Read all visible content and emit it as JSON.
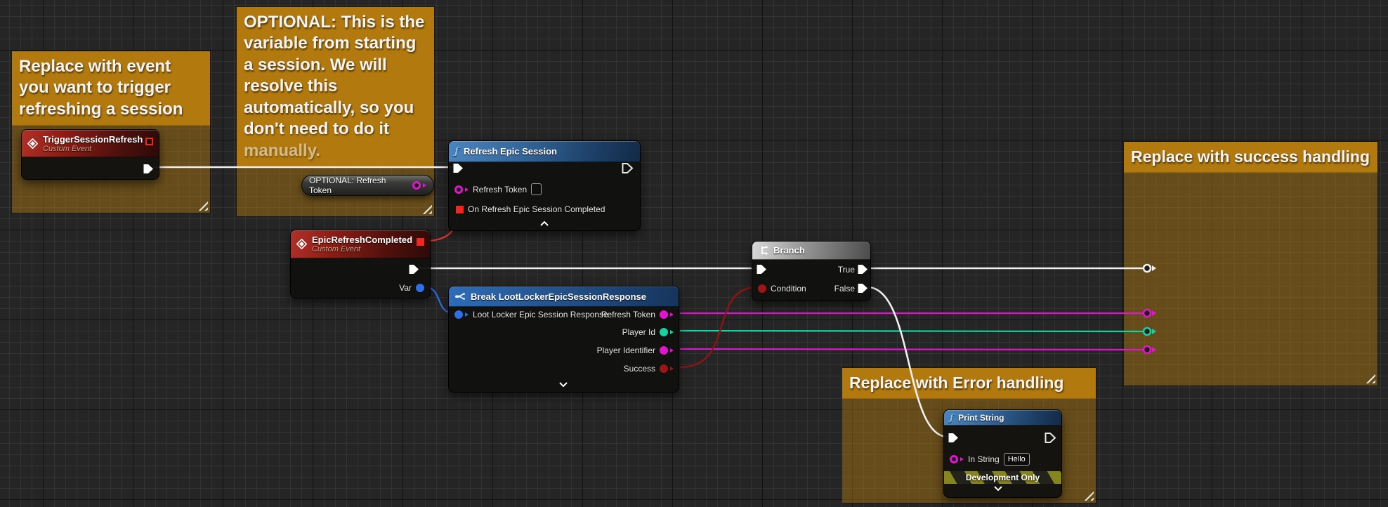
{
  "comments": {
    "trigger": {
      "title": "Replace with event you want to trigger refreshing a session"
    },
    "optional": {
      "title": "OPTIONAL: This is the variable from starting a session. We will resolve this automatically, so you don't need to do it manually."
    },
    "success": {
      "title": "Replace with success handling"
    },
    "error": {
      "title": "Replace with Error handling"
    }
  },
  "nodes": {
    "trigger_event": {
      "title": "TriggerSessionRefresh",
      "subtitle": "Custom Event"
    },
    "refresh_epic_session": {
      "title": "Refresh Epic Session",
      "refresh_token_label": "Refresh Token",
      "on_completed_label": "On Refresh Epic Session Completed"
    },
    "optional_refresh_token_var": {
      "label": "OPTIONAL: Refresh Token"
    },
    "epic_refresh_completed": {
      "title": "EpicRefreshCompleted",
      "subtitle": "Custom Event",
      "var_label": "Var"
    },
    "break_response": {
      "title": "Break LootLockerEpicSessionResponse",
      "input_label": "Loot Locker Epic Session Response",
      "outputs": [
        "Refresh Token",
        "Player Id",
        "Player Identifier",
        "Success"
      ]
    },
    "branch": {
      "title": "Branch",
      "condition_label": "Condition",
      "true_label": "True",
      "false_label": "False"
    },
    "print_string": {
      "title": "Print String",
      "in_string_label": "In String",
      "in_string_value": "Hello",
      "banner": "Development Only"
    }
  },
  "colors": {
    "comment_header": "#b1790e",
    "comment_body": "rgba(177,122,15,0.47)",
    "exec_wire": "#f0f0f0",
    "string_pin_magenta": "#e215cd",
    "text_pin_teal": "#17d1a0",
    "object_pin_blue": "#2e6fe8",
    "bool_pin_dark_red": "#8e1414",
    "delegate_pin_red": "#f3261f",
    "event_header_red": "#8c1d15",
    "function_header_blue": "#36699e",
    "branch_header_gray": "#9a9a9a"
  }
}
